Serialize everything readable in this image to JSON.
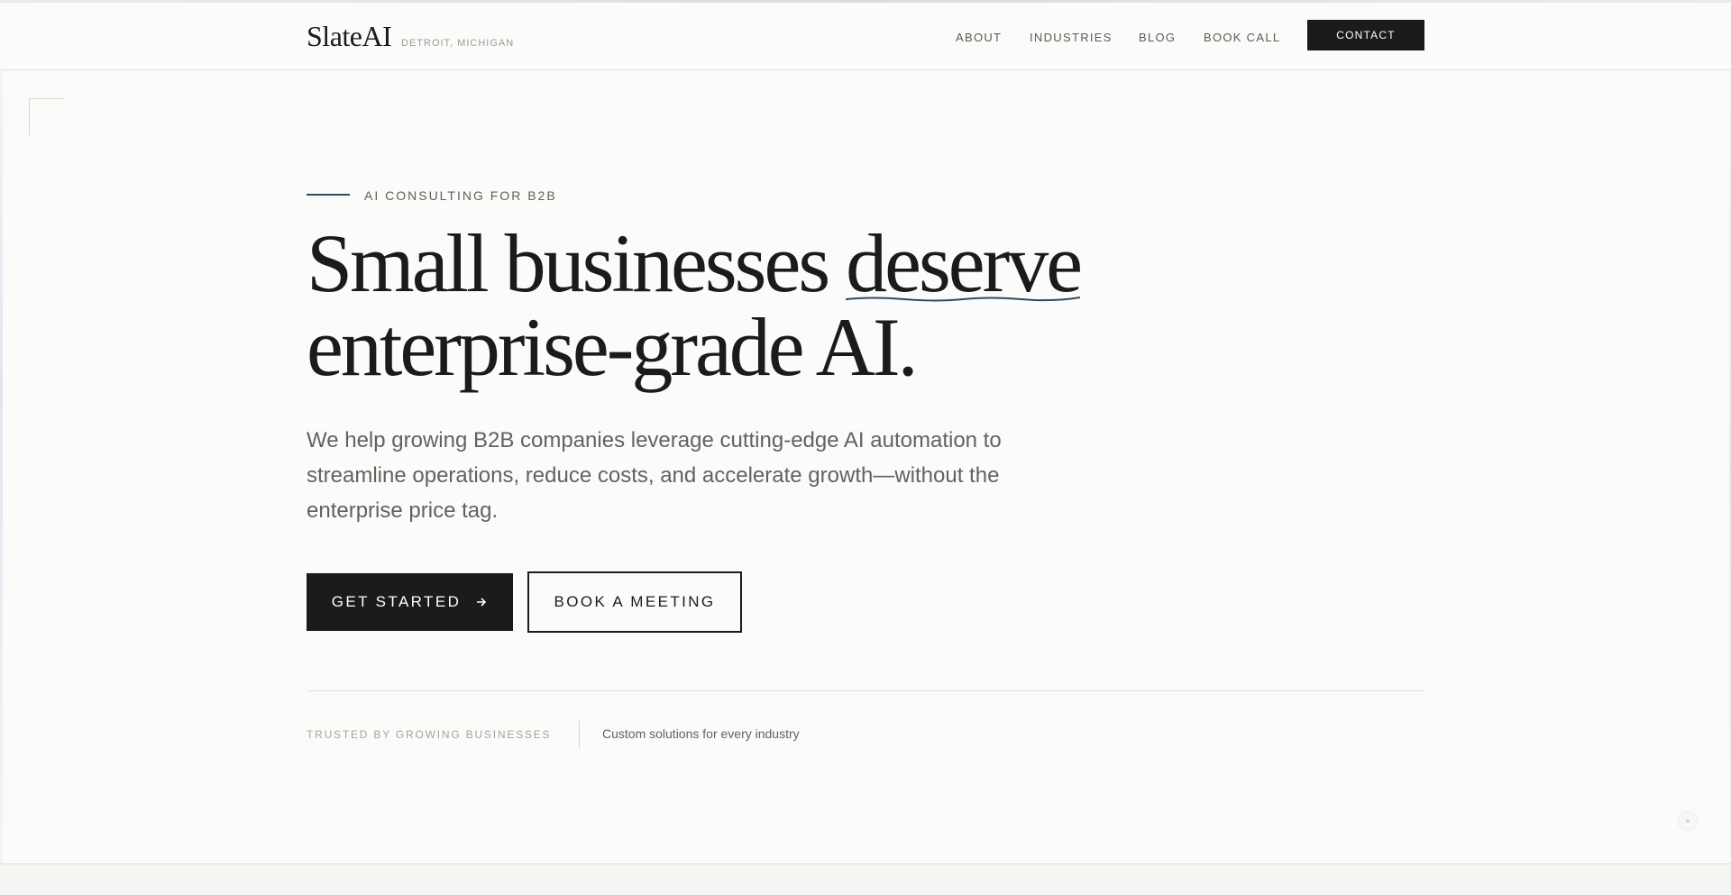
{
  "brand": {
    "name": "SlateAI",
    "location": "DETROIT, MICHIGAN"
  },
  "nav": {
    "items": [
      {
        "label": "ABOUT"
      },
      {
        "label": "INDUSTRIES"
      },
      {
        "label": "BLOG"
      },
      {
        "label": "BOOK CALL"
      }
    ],
    "contact_label": "CONTACT"
  },
  "hero": {
    "eyebrow": "AI CONSULTING FOR B2B",
    "headline_line1_pre": "Small businesses ",
    "headline_line1_accent": "deserve",
    "headline_line2": "enterprise-grade AI.",
    "lede": "We help growing B2B companies leverage cutting-edge AI automation to streamline operations, reduce costs, and accelerate growth—without the enterprise price tag.",
    "cta_primary": "GET STARTED",
    "cta_primary_icon": "arrow-right-icon",
    "cta_secondary": "BOOK A MEETING"
  },
  "trust": {
    "label": "TRUSTED BY GROWING BUSINESSES",
    "note": "Custom solutions for every industry"
  },
  "colors": {
    "ink": "#1b1b1b",
    "background": "#fbfbf9",
    "accent": "#2f4a64",
    "muted_text": "#626260"
  }
}
